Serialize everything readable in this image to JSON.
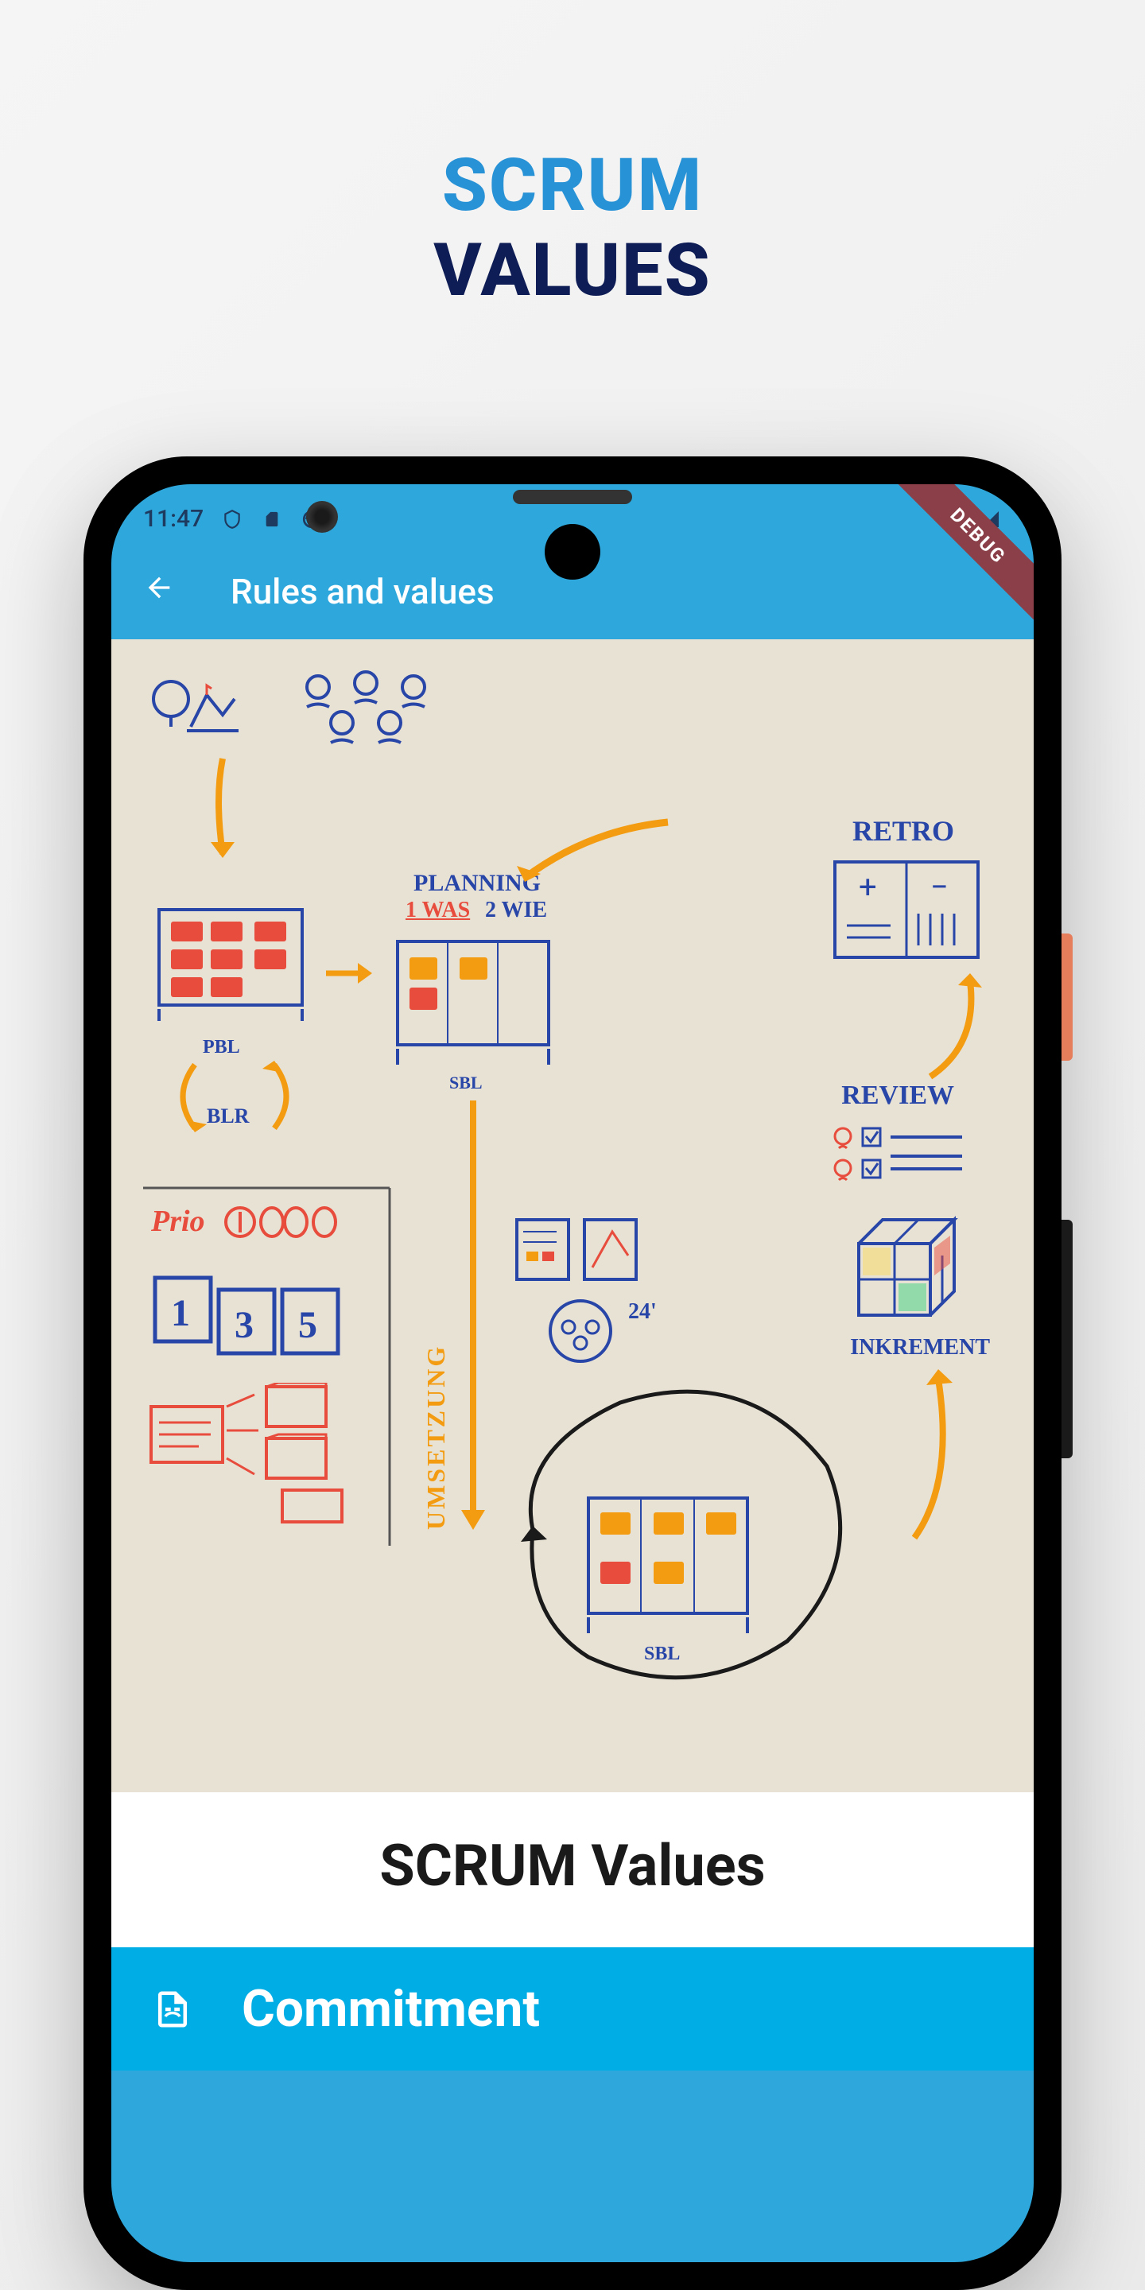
{
  "page": {
    "title_line1": "SCRUM",
    "title_line2": "VALUES"
  },
  "phone": {
    "status_bar": {
      "time": "11:47",
      "icons": {
        "shield": "shield-icon",
        "sd_card": "sd-card-icon",
        "circle": "circle-icon",
        "wifi": "wifi-icon",
        "signal": "signal-icon"
      }
    },
    "debug_label": "DEBUG",
    "app_bar": {
      "title": "Rules and values"
    },
    "whiteboard": {
      "labels": {
        "retro": "RETRO",
        "planning": "PLANNING",
        "was": "1 WAS",
        "wie": "2 WIE",
        "pbl": "PBL",
        "blr": "BLR",
        "sbl": "SBL",
        "sbl2": "SBL",
        "review": "REVIEW",
        "inkrement": "INKREMENT",
        "prio": "Prio",
        "umsetzung": "UMSETZUNG",
        "time24": "24'",
        "num1": "1",
        "num3": "3",
        "num5": "5"
      }
    },
    "content": {
      "section_title": "SCRUM Values",
      "value_label": "Commitment"
    }
  }
}
